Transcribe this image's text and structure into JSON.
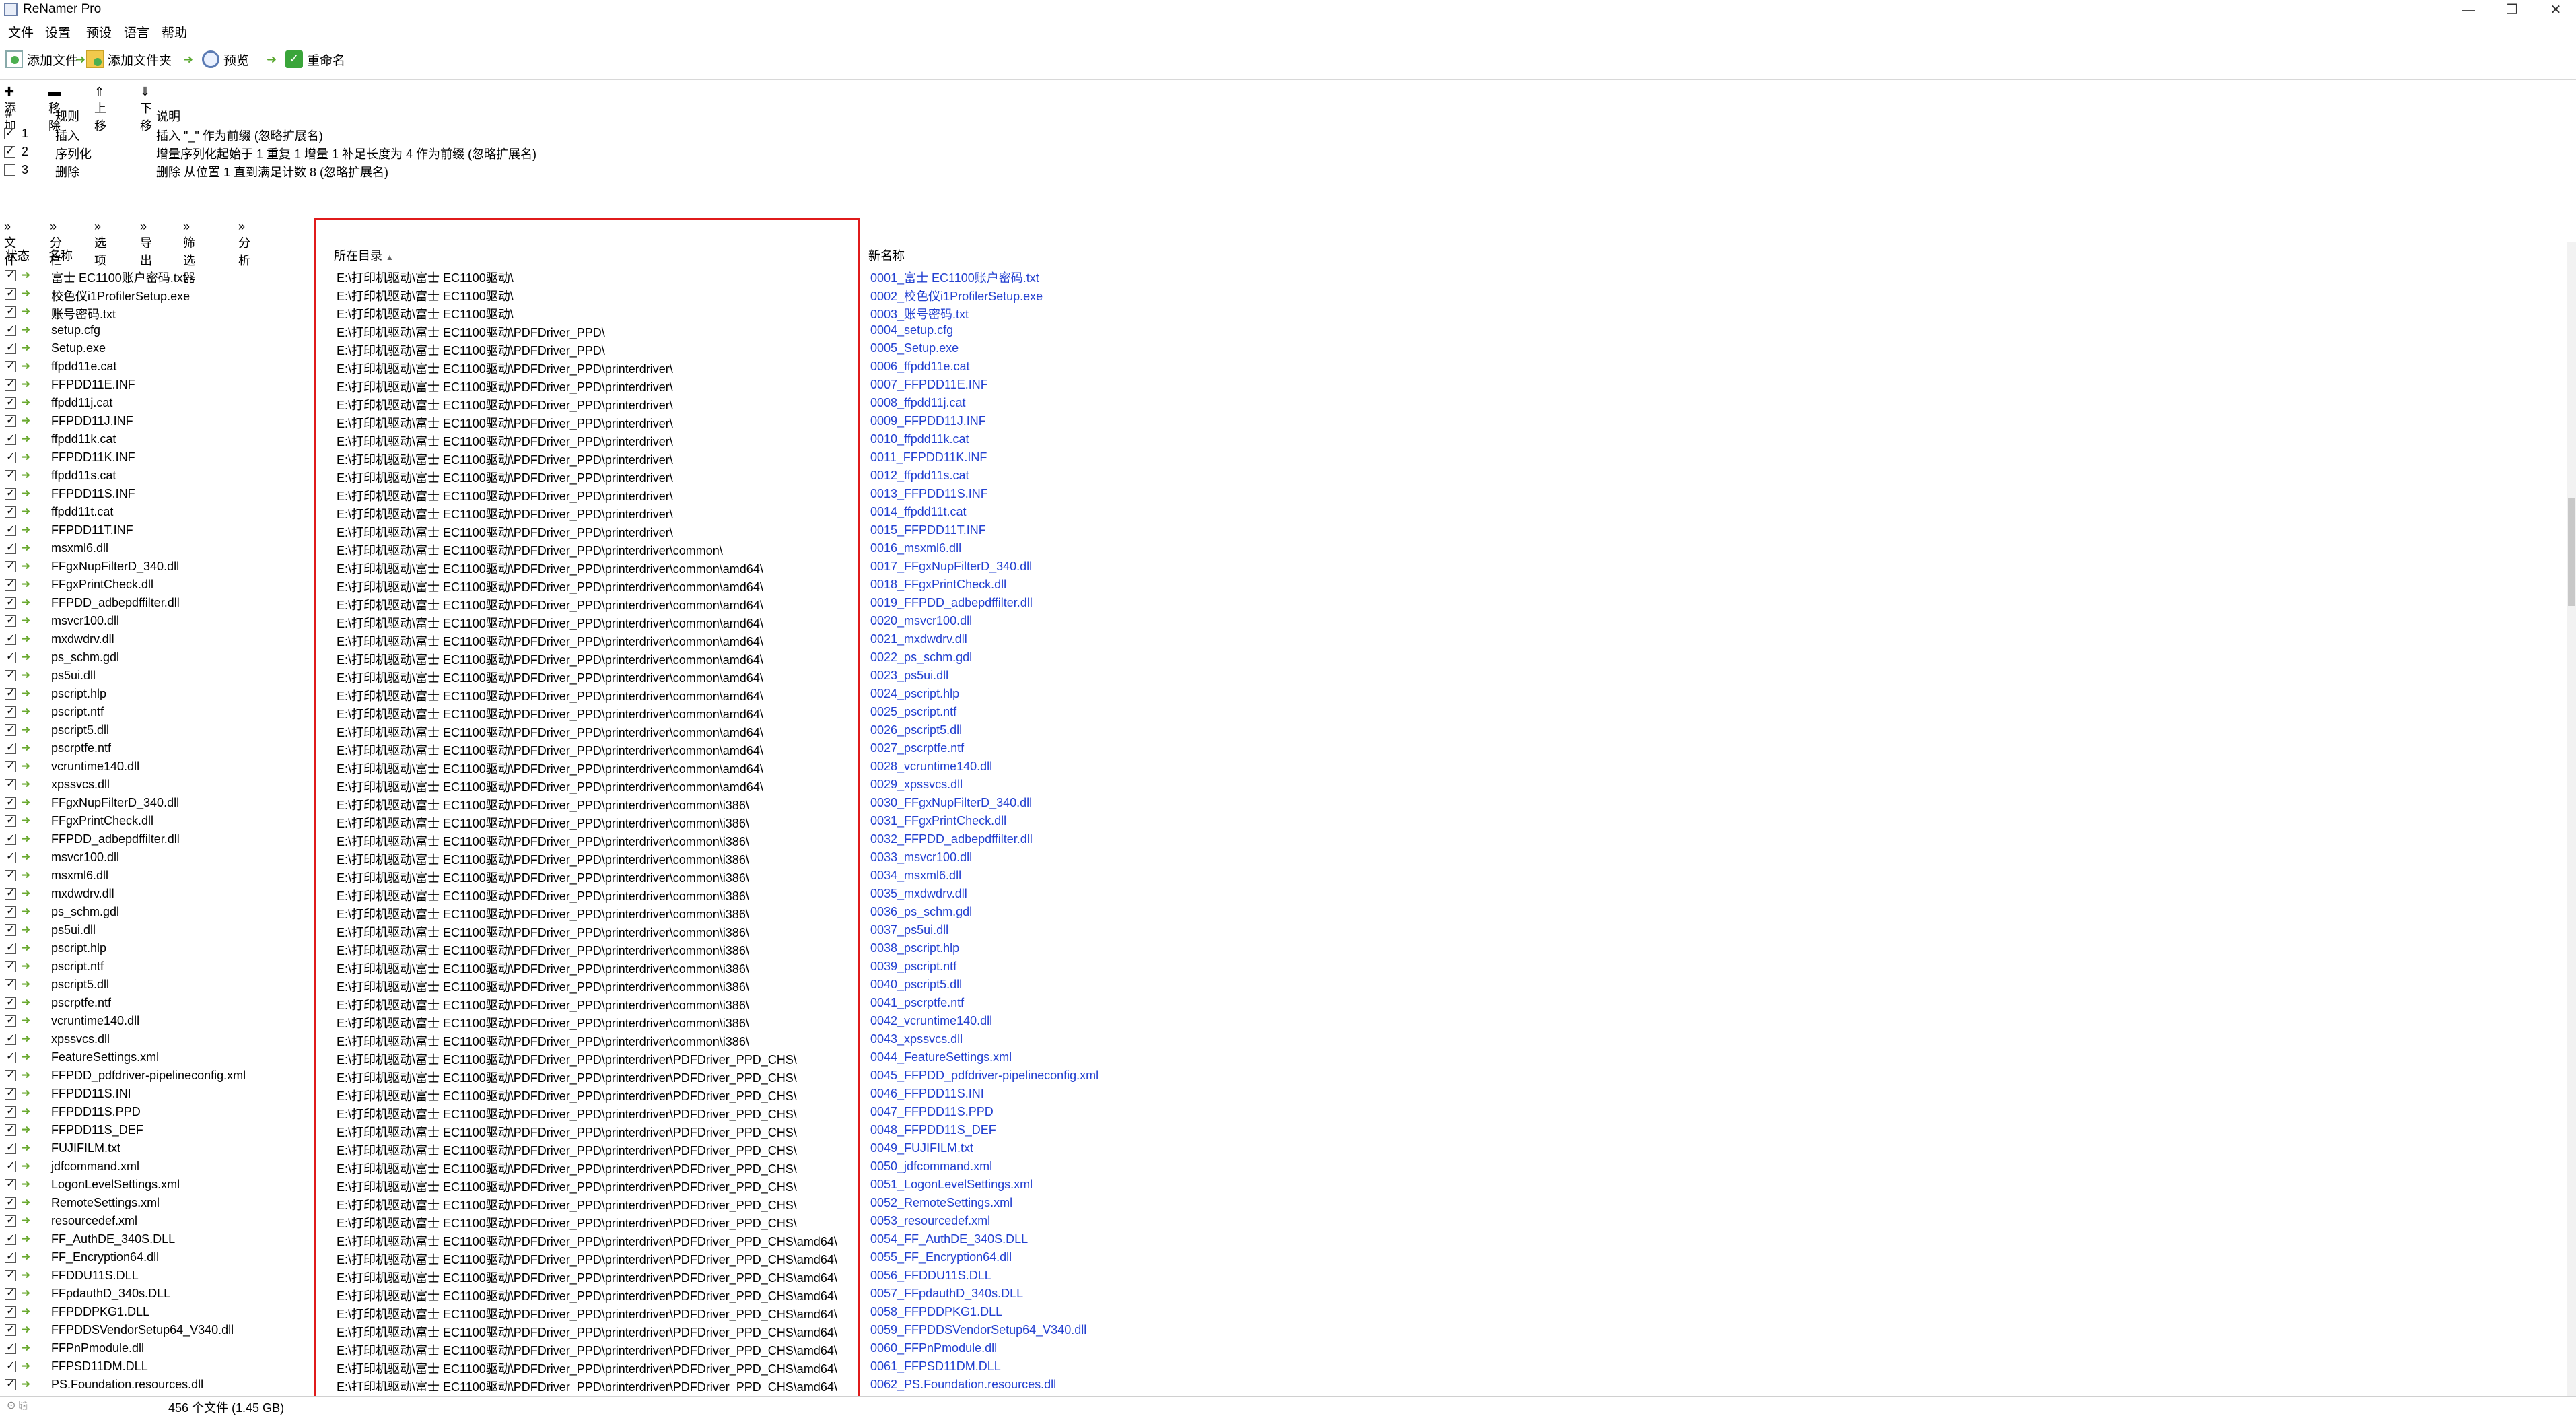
{
  "window": {
    "title": "ReNamer Pro"
  },
  "menu": [
    "文件",
    "设置",
    "预设",
    "语言",
    "帮助"
  ],
  "toolbar": {
    "add_files": "添加文件",
    "add_folders": "添加文件夹",
    "preview": "预览",
    "rename": "重命名"
  },
  "rules_toolbar": [
    "添加",
    "移除",
    "上移",
    "下移"
  ],
  "rules_header": {
    "num": "#",
    "rule": "规则",
    "desc": "说明"
  },
  "rules": [
    {
      "num": "1",
      "checked": true,
      "rule": "插入",
      "desc": "插入 \"_\" 作为前缀 (忽略扩展名)"
    },
    {
      "num": "2",
      "checked": true,
      "rule": "序列化",
      "desc": "增量序列化起始于 1 重复 1 增量 1 补足长度为 4 作为前缀 (忽略扩展名)"
    },
    {
      "num": "3",
      "checked": false,
      "rule": "删除",
      "desc": "删除 从位置 1 直到满足计数 8 (忽略扩展名)"
    }
  ],
  "files_toolbar": [
    "文件",
    "分栏",
    "选项",
    "导出",
    "筛选器",
    "分析"
  ],
  "files_header": {
    "status": "状态",
    "name": "名称",
    "path": "所在目录",
    "new_name": "新名称"
  },
  "files": [
    {
      "name": "富士 EC1100账户密码.txt",
      "path": "E:\\打印机驱动\\富士 EC1100驱动\\",
      "new_name": "0001_富士 EC1100账户密码.txt"
    },
    {
      "name": "校色仪i1ProfilerSetup.exe",
      "path": "E:\\打印机驱动\\富士 EC1100驱动\\",
      "new_name": "0002_校色仪i1ProfilerSetup.exe"
    },
    {
      "name": "账号密码.txt",
      "path": "E:\\打印机驱动\\富士 EC1100驱动\\",
      "new_name": "0003_账号密码.txt"
    },
    {
      "name": "setup.cfg",
      "path": "E:\\打印机驱动\\富士 EC1100驱动\\PDFDriver_PPD\\",
      "new_name": "0004_setup.cfg"
    },
    {
      "name": "Setup.exe",
      "path": "E:\\打印机驱动\\富士 EC1100驱动\\PDFDriver_PPD\\",
      "new_name": "0005_Setup.exe"
    },
    {
      "name": "ffpdd11e.cat",
      "path": "E:\\打印机驱动\\富士 EC1100驱动\\PDFDriver_PPD\\printerdriver\\",
      "new_name": "0006_ffpdd11e.cat"
    },
    {
      "name": "FFPDD11E.INF",
      "path": "E:\\打印机驱动\\富士 EC1100驱动\\PDFDriver_PPD\\printerdriver\\",
      "new_name": "0007_FFPDD11E.INF"
    },
    {
      "name": "ffpdd11j.cat",
      "path": "E:\\打印机驱动\\富士 EC1100驱动\\PDFDriver_PPD\\printerdriver\\",
      "new_name": "0008_ffpdd11j.cat"
    },
    {
      "name": "FFPDD11J.INF",
      "path": "E:\\打印机驱动\\富士 EC1100驱动\\PDFDriver_PPD\\printerdriver\\",
      "new_name": "0009_FFPDD11J.INF"
    },
    {
      "name": "ffpdd11k.cat",
      "path": "E:\\打印机驱动\\富士 EC1100驱动\\PDFDriver_PPD\\printerdriver\\",
      "new_name": "0010_ffpdd11k.cat"
    },
    {
      "name": "FFPDD11K.INF",
      "path": "E:\\打印机驱动\\富士 EC1100驱动\\PDFDriver_PPD\\printerdriver\\",
      "new_name": "0011_FFPDD11K.INF"
    },
    {
      "name": "ffpdd11s.cat",
      "path": "E:\\打印机驱动\\富士 EC1100驱动\\PDFDriver_PPD\\printerdriver\\",
      "new_name": "0012_ffpdd11s.cat"
    },
    {
      "name": "FFPDD11S.INF",
      "path": "E:\\打印机驱动\\富士 EC1100驱动\\PDFDriver_PPD\\printerdriver\\",
      "new_name": "0013_FFPDD11S.INF"
    },
    {
      "name": "ffpdd11t.cat",
      "path": "E:\\打印机驱动\\富士 EC1100驱动\\PDFDriver_PPD\\printerdriver\\",
      "new_name": "0014_ffpdd11t.cat"
    },
    {
      "name": "FFPDD11T.INF",
      "path": "E:\\打印机驱动\\富士 EC1100驱动\\PDFDriver_PPD\\printerdriver\\",
      "new_name": "0015_FFPDD11T.INF"
    },
    {
      "name": "msxml6.dll",
      "path": "E:\\打印机驱动\\富士 EC1100驱动\\PDFDriver_PPD\\printerdriver\\common\\",
      "new_name": "0016_msxml6.dll"
    },
    {
      "name": "FFgxNupFilterD_340.dll",
      "path": "E:\\打印机驱动\\富士 EC1100驱动\\PDFDriver_PPD\\printerdriver\\common\\amd64\\",
      "new_name": "0017_FFgxNupFilterD_340.dll"
    },
    {
      "name": "FFgxPrintCheck.dll",
      "path": "E:\\打印机驱动\\富士 EC1100驱动\\PDFDriver_PPD\\printerdriver\\common\\amd64\\",
      "new_name": "0018_FFgxPrintCheck.dll"
    },
    {
      "name": "FFPDD_adbepdffilter.dll",
      "path": "E:\\打印机驱动\\富士 EC1100驱动\\PDFDriver_PPD\\printerdriver\\common\\amd64\\",
      "new_name": "0019_FFPDD_adbepdffilter.dll"
    },
    {
      "name": "msvcr100.dll",
      "path": "E:\\打印机驱动\\富士 EC1100驱动\\PDFDriver_PPD\\printerdriver\\common\\amd64\\",
      "new_name": "0020_msvcr100.dll"
    },
    {
      "name": "mxdwdrv.dll",
      "path": "E:\\打印机驱动\\富士 EC1100驱动\\PDFDriver_PPD\\printerdriver\\common\\amd64\\",
      "new_name": "0021_mxdwdrv.dll"
    },
    {
      "name": "ps_schm.gdl",
      "path": "E:\\打印机驱动\\富士 EC1100驱动\\PDFDriver_PPD\\printerdriver\\common\\amd64\\",
      "new_name": "0022_ps_schm.gdl"
    },
    {
      "name": "ps5ui.dll",
      "path": "E:\\打印机驱动\\富士 EC1100驱动\\PDFDriver_PPD\\printerdriver\\common\\amd64\\",
      "new_name": "0023_ps5ui.dll"
    },
    {
      "name": "pscript.hlp",
      "path": "E:\\打印机驱动\\富士 EC1100驱动\\PDFDriver_PPD\\printerdriver\\common\\amd64\\",
      "new_name": "0024_pscript.hlp"
    },
    {
      "name": "pscript.ntf",
      "path": "E:\\打印机驱动\\富士 EC1100驱动\\PDFDriver_PPD\\printerdriver\\common\\amd64\\",
      "new_name": "0025_pscript.ntf"
    },
    {
      "name": "pscript5.dll",
      "path": "E:\\打印机驱动\\富士 EC1100驱动\\PDFDriver_PPD\\printerdriver\\common\\amd64\\",
      "new_name": "0026_pscript5.dll"
    },
    {
      "name": "pscrptfe.ntf",
      "path": "E:\\打印机驱动\\富士 EC1100驱动\\PDFDriver_PPD\\printerdriver\\common\\amd64\\",
      "new_name": "0027_pscrptfe.ntf"
    },
    {
      "name": "vcruntime140.dll",
      "path": "E:\\打印机驱动\\富士 EC1100驱动\\PDFDriver_PPD\\printerdriver\\common\\amd64\\",
      "new_name": "0028_vcruntime140.dll"
    },
    {
      "name": "xpssvcs.dll",
      "path": "E:\\打印机驱动\\富士 EC1100驱动\\PDFDriver_PPD\\printerdriver\\common\\amd64\\",
      "new_name": "0029_xpssvcs.dll"
    },
    {
      "name": "FFgxNupFilterD_340.dll",
      "path": "E:\\打印机驱动\\富士 EC1100驱动\\PDFDriver_PPD\\printerdriver\\common\\i386\\",
      "new_name": "0030_FFgxNupFilterD_340.dll"
    },
    {
      "name": "FFgxPrintCheck.dll",
      "path": "E:\\打印机驱动\\富士 EC1100驱动\\PDFDriver_PPD\\printerdriver\\common\\i386\\",
      "new_name": "0031_FFgxPrintCheck.dll"
    },
    {
      "name": "FFPDD_adbepdffilter.dll",
      "path": "E:\\打印机驱动\\富士 EC1100驱动\\PDFDriver_PPD\\printerdriver\\common\\i386\\",
      "new_name": "0032_FFPDD_adbepdffilter.dll"
    },
    {
      "name": "msvcr100.dll",
      "path": "E:\\打印机驱动\\富士 EC1100驱动\\PDFDriver_PPD\\printerdriver\\common\\i386\\",
      "new_name": "0033_msvcr100.dll"
    },
    {
      "name": "msxml6.dll",
      "path": "E:\\打印机驱动\\富士 EC1100驱动\\PDFDriver_PPD\\printerdriver\\common\\i386\\",
      "new_name": "0034_msxml6.dll"
    },
    {
      "name": "mxdwdrv.dll",
      "path": "E:\\打印机驱动\\富士 EC1100驱动\\PDFDriver_PPD\\printerdriver\\common\\i386\\",
      "new_name": "0035_mxdwdrv.dll"
    },
    {
      "name": "ps_schm.gdl",
      "path": "E:\\打印机驱动\\富士 EC1100驱动\\PDFDriver_PPD\\printerdriver\\common\\i386\\",
      "new_name": "0036_ps_schm.gdl"
    },
    {
      "name": "ps5ui.dll",
      "path": "E:\\打印机驱动\\富士 EC1100驱动\\PDFDriver_PPD\\printerdriver\\common\\i386\\",
      "new_name": "0037_ps5ui.dll"
    },
    {
      "name": "pscript.hlp",
      "path": "E:\\打印机驱动\\富士 EC1100驱动\\PDFDriver_PPD\\printerdriver\\common\\i386\\",
      "new_name": "0038_pscript.hlp"
    },
    {
      "name": "pscript.ntf",
      "path": "E:\\打印机驱动\\富士 EC1100驱动\\PDFDriver_PPD\\printerdriver\\common\\i386\\",
      "new_name": "0039_pscript.ntf"
    },
    {
      "name": "pscript5.dll",
      "path": "E:\\打印机驱动\\富士 EC1100驱动\\PDFDriver_PPD\\printerdriver\\common\\i386\\",
      "new_name": "0040_pscript5.dll"
    },
    {
      "name": "pscrptfe.ntf",
      "path": "E:\\打印机驱动\\富士 EC1100驱动\\PDFDriver_PPD\\printerdriver\\common\\i386\\",
      "new_name": "0041_pscrptfe.ntf"
    },
    {
      "name": "vcruntime140.dll",
      "path": "E:\\打印机驱动\\富士 EC1100驱动\\PDFDriver_PPD\\printerdriver\\common\\i386\\",
      "new_name": "0042_vcruntime140.dll"
    },
    {
      "name": "xpssvcs.dll",
      "path": "E:\\打印机驱动\\富士 EC1100驱动\\PDFDriver_PPD\\printerdriver\\common\\i386\\",
      "new_name": "0043_xpssvcs.dll"
    },
    {
      "name": "FeatureSettings.xml",
      "path": "E:\\打印机驱动\\富士 EC1100驱动\\PDFDriver_PPD\\printerdriver\\PDFDriver_PPD_CHS\\",
      "new_name": "0044_FeatureSettings.xml"
    },
    {
      "name": "FFPDD_pdfdriver-pipelineconfig.xml",
      "path": "E:\\打印机驱动\\富士 EC1100驱动\\PDFDriver_PPD\\printerdriver\\PDFDriver_PPD_CHS\\",
      "new_name": "0045_FFPDD_pdfdriver-pipelineconfig.xml"
    },
    {
      "name": "FFPDD11S.INI",
      "path": "E:\\打印机驱动\\富士 EC1100驱动\\PDFDriver_PPD\\printerdriver\\PDFDriver_PPD_CHS\\",
      "new_name": "0046_FFPDD11S.INI"
    },
    {
      "name": "FFPDD11S.PPD",
      "path": "E:\\打印机驱动\\富士 EC1100驱动\\PDFDriver_PPD\\printerdriver\\PDFDriver_PPD_CHS\\",
      "new_name": "0047_FFPDD11S.PPD"
    },
    {
      "name": "FFPDD11S_DEF",
      "path": "E:\\打印机驱动\\富士 EC1100驱动\\PDFDriver_PPD\\printerdriver\\PDFDriver_PPD_CHS\\",
      "new_name": "0048_FFPDD11S_DEF"
    },
    {
      "name": "FUJIFILM.txt",
      "path": "E:\\打印机驱动\\富士 EC1100驱动\\PDFDriver_PPD\\printerdriver\\PDFDriver_PPD_CHS\\",
      "new_name": "0049_FUJIFILM.txt"
    },
    {
      "name": "jdfcommand.xml",
      "path": "E:\\打印机驱动\\富士 EC1100驱动\\PDFDriver_PPD\\printerdriver\\PDFDriver_PPD_CHS\\",
      "new_name": "0050_jdfcommand.xml"
    },
    {
      "name": "LogonLevelSettings.xml",
      "path": "E:\\打印机驱动\\富士 EC1100驱动\\PDFDriver_PPD\\printerdriver\\PDFDriver_PPD_CHS\\",
      "new_name": "0051_LogonLevelSettings.xml"
    },
    {
      "name": "RemoteSettings.xml",
      "path": "E:\\打印机驱动\\富士 EC1100驱动\\PDFDriver_PPD\\printerdriver\\PDFDriver_PPD_CHS\\",
      "new_name": "0052_RemoteSettings.xml"
    },
    {
      "name": "resourcedef.xml",
      "path": "E:\\打印机驱动\\富士 EC1100驱动\\PDFDriver_PPD\\printerdriver\\PDFDriver_PPD_CHS\\",
      "new_name": "0053_resourcedef.xml"
    },
    {
      "name": "FF_AuthDE_340S.DLL",
      "path": "E:\\打印机驱动\\富士 EC1100驱动\\PDFDriver_PPD\\printerdriver\\PDFDriver_PPD_CHS\\amd64\\",
      "new_name": "0054_FF_AuthDE_340S.DLL"
    },
    {
      "name": "FF_Encryption64.dll",
      "path": "E:\\打印机驱动\\富士 EC1100驱动\\PDFDriver_PPD\\printerdriver\\PDFDriver_PPD_CHS\\amd64\\",
      "new_name": "0055_FF_Encryption64.dll"
    },
    {
      "name": "FFDDU11S.DLL",
      "path": "E:\\打印机驱动\\富士 EC1100驱动\\PDFDriver_PPD\\printerdriver\\PDFDriver_PPD_CHS\\amd64\\",
      "new_name": "0056_FFDDU11S.DLL"
    },
    {
      "name": "FFpdauthD_340s.DLL",
      "path": "E:\\打印机驱动\\富士 EC1100驱动\\PDFDriver_PPD\\printerdriver\\PDFDriver_PPD_CHS\\amd64\\",
      "new_name": "0057_FFpdauthD_340s.DLL"
    },
    {
      "name": "FFPDDPKG1.DLL",
      "path": "E:\\打印机驱动\\富士 EC1100驱动\\PDFDriver_PPD\\printerdriver\\PDFDriver_PPD_CHS\\amd64\\",
      "new_name": "0058_FFPDDPKG1.DLL"
    },
    {
      "name": "FFPDDSVendorSetup64_V340.dll",
      "path": "E:\\打印机驱动\\富士 EC1100驱动\\PDFDriver_PPD\\printerdriver\\PDFDriver_PPD_CHS\\amd64\\",
      "new_name": "0059_FFPDDSVendorSetup64_V340.dll"
    },
    {
      "name": "FFPnPmodule.dll",
      "path": "E:\\打印机驱动\\富士 EC1100驱动\\PDFDriver_PPD\\printerdriver\\PDFDriver_PPD_CHS\\amd64\\",
      "new_name": "0060_FFPnPmodule.dll"
    },
    {
      "name": "FFPSD11DM.DLL",
      "path": "E:\\打印机驱动\\富士 EC1100驱动\\PDFDriver_PPD\\printerdriver\\PDFDriver_PPD_CHS\\amd64\\",
      "new_name": "0061_FFPSD11DM.DLL"
    },
    {
      "name": "PS.Foundation.resources.dll",
      "path": "E:\\打印机驱动\\富士 EC1100驱动\\PDFDriver_PPD\\printerdriver\\PDFDriver_PPD_CHS\\amd64\\",
      "new_name": "0062_PS.Foundation.resources.dll"
    }
  ],
  "status": {
    "count": "456 个文件 (1.45 GB)"
  },
  "colors": {
    "new_name": "#2340d0",
    "highlight": "#e01b1b",
    "status_ok": "#6aa92f"
  }
}
